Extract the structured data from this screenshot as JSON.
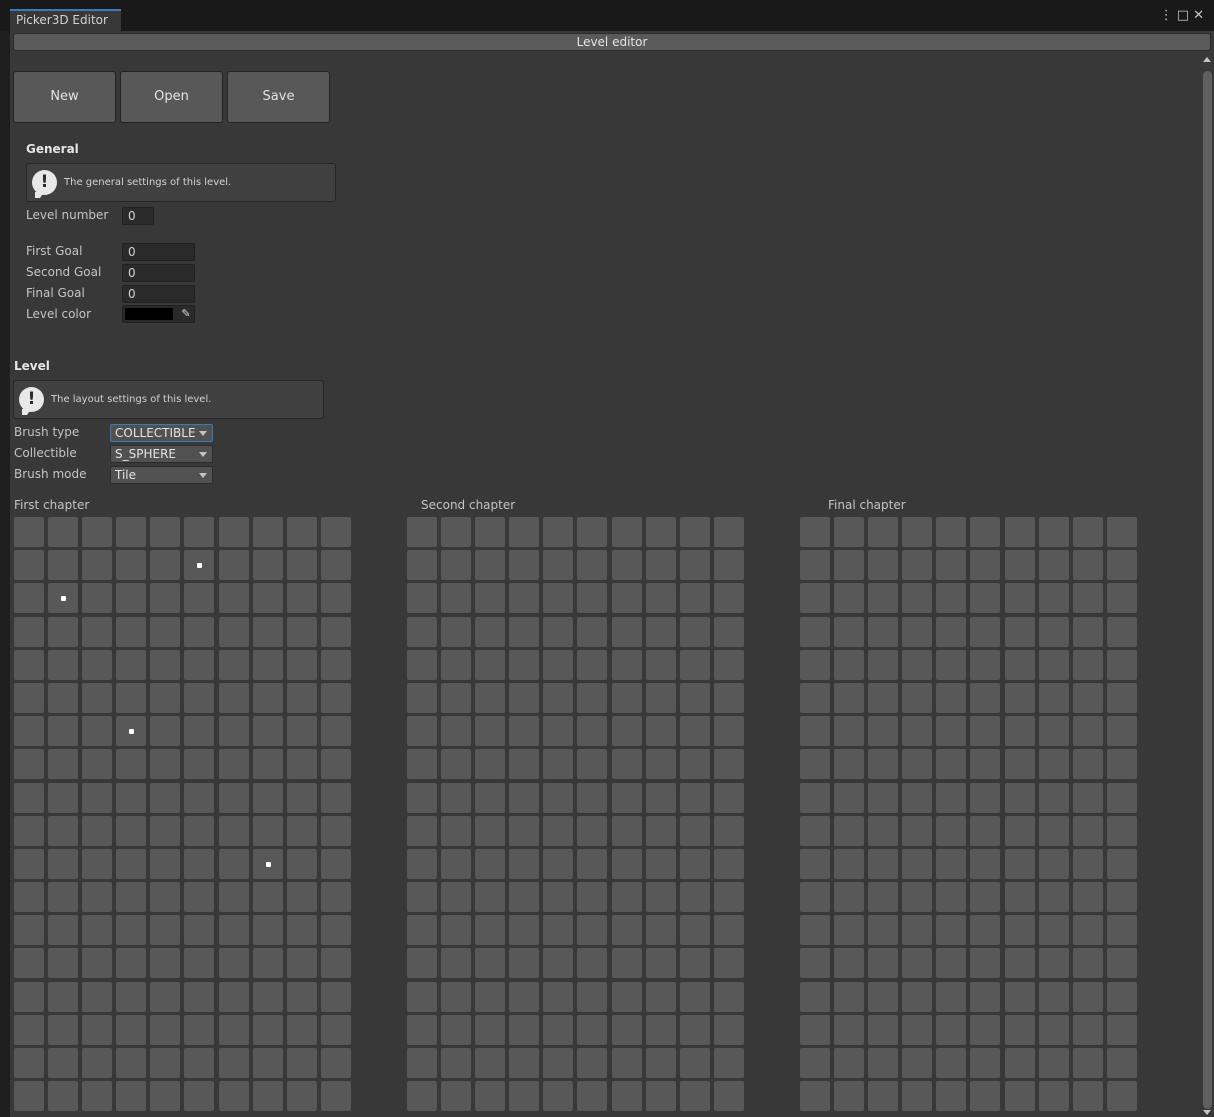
{
  "window": {
    "tab_title": "Picker3D Editor",
    "controls": [
      "⋮",
      "□",
      "✕"
    ]
  },
  "header": {
    "title": "Level editor"
  },
  "toolbar": {
    "new_label": "New",
    "open_label": "Open",
    "save_label": "Save"
  },
  "general": {
    "title": "General",
    "help": "The general settings of this level.",
    "level_number_label": "Level number",
    "level_number_value": "0",
    "first_goal_label": "First Goal",
    "first_goal_value": "0",
    "second_goal_label": "Second Goal",
    "second_goal_value": "0",
    "final_goal_label": "Final Goal",
    "final_goal_value": "0",
    "level_color_label": "Level color",
    "level_color_value": "#000000"
  },
  "level": {
    "title": "Level",
    "help": "The layout settings of this level.",
    "brush_type_label": "Brush type",
    "brush_type_value": "COLLECTIBLE",
    "collectible_label": "Collectible",
    "collectible_value": "S_SPHERE",
    "brush_mode_label": "Brush mode",
    "brush_mode_value": "Tile"
  },
  "chapters": [
    {
      "title": "First chapter",
      "filled": [
        [
          1,
          5
        ],
        [
          2,
          1
        ],
        [
          6,
          3
        ],
        [
          10,
          7
        ]
      ]
    },
    {
      "title": "Second chapter",
      "filled": []
    },
    {
      "title": "Final chapter",
      "filled": []
    }
  ],
  "grid": {
    "cols": 10,
    "rows": 18
  },
  "colors": {
    "accent": "#3a79bb",
    "cell": "#585858",
    "panel": "#383838"
  }
}
